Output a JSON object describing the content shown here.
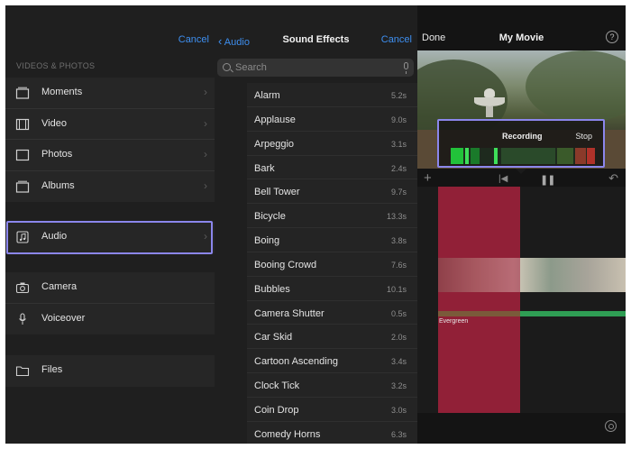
{
  "media_browser": {
    "cancel_label": "Cancel",
    "section_label": "VIDEOS & PHOTOS",
    "items": [
      {
        "label": "Moments",
        "icon": "moments-icon"
      },
      {
        "label": "Video",
        "icon": "film-icon"
      },
      {
        "label": "Photos",
        "icon": "photo-icon"
      },
      {
        "label": "Albums",
        "icon": "albums-icon"
      },
      {
        "label": "Audio",
        "icon": "music-note-icon"
      },
      {
        "label": "Camera",
        "icon": "camera-icon"
      },
      {
        "label": "Voiceover",
        "icon": "microphone-icon"
      },
      {
        "label": "Files",
        "icon": "folder-icon"
      }
    ],
    "highlight_color": "#8b86ec"
  },
  "sound_effects": {
    "back_label": "Audio",
    "title": "Sound Effects",
    "cancel_label": "Cancel",
    "search_placeholder": "Search",
    "items": [
      {
        "name": "Alarm",
        "duration": "5.2s"
      },
      {
        "name": "Applause",
        "duration": "9.0s"
      },
      {
        "name": "Arpeggio",
        "duration": "3.1s"
      },
      {
        "name": "Bark",
        "duration": "2.4s"
      },
      {
        "name": "Bell Tower",
        "duration": "9.7s"
      },
      {
        "name": "Bicycle",
        "duration": "13.3s"
      },
      {
        "name": "Boing",
        "duration": "3.8s"
      },
      {
        "name": "Booing Crowd",
        "duration": "7.6s"
      },
      {
        "name": "Bubbles",
        "duration": "10.1s"
      },
      {
        "name": "Camera Shutter",
        "duration": "0.5s"
      },
      {
        "name": "Car Skid",
        "duration": "2.0s"
      },
      {
        "name": "Cartoon Ascending",
        "duration": "3.4s"
      },
      {
        "name": "Clock Tick",
        "duration": "3.2s"
      },
      {
        "name": "Coin Drop",
        "duration": "3.0s"
      },
      {
        "name": "Comedy Horns",
        "duration": "6.3s"
      }
    ]
  },
  "editor": {
    "done_label": "Done",
    "title": "My Movie",
    "help_label": "?",
    "recording_label": "Recording",
    "stop_label": "Stop",
    "music_track_label": "Evergreen",
    "colors": {
      "recording_clip": "#8a2437",
      "music_track": "#2f9e54",
      "meter_green": "#22c23a",
      "meter_red": "#d83a2a"
    }
  }
}
